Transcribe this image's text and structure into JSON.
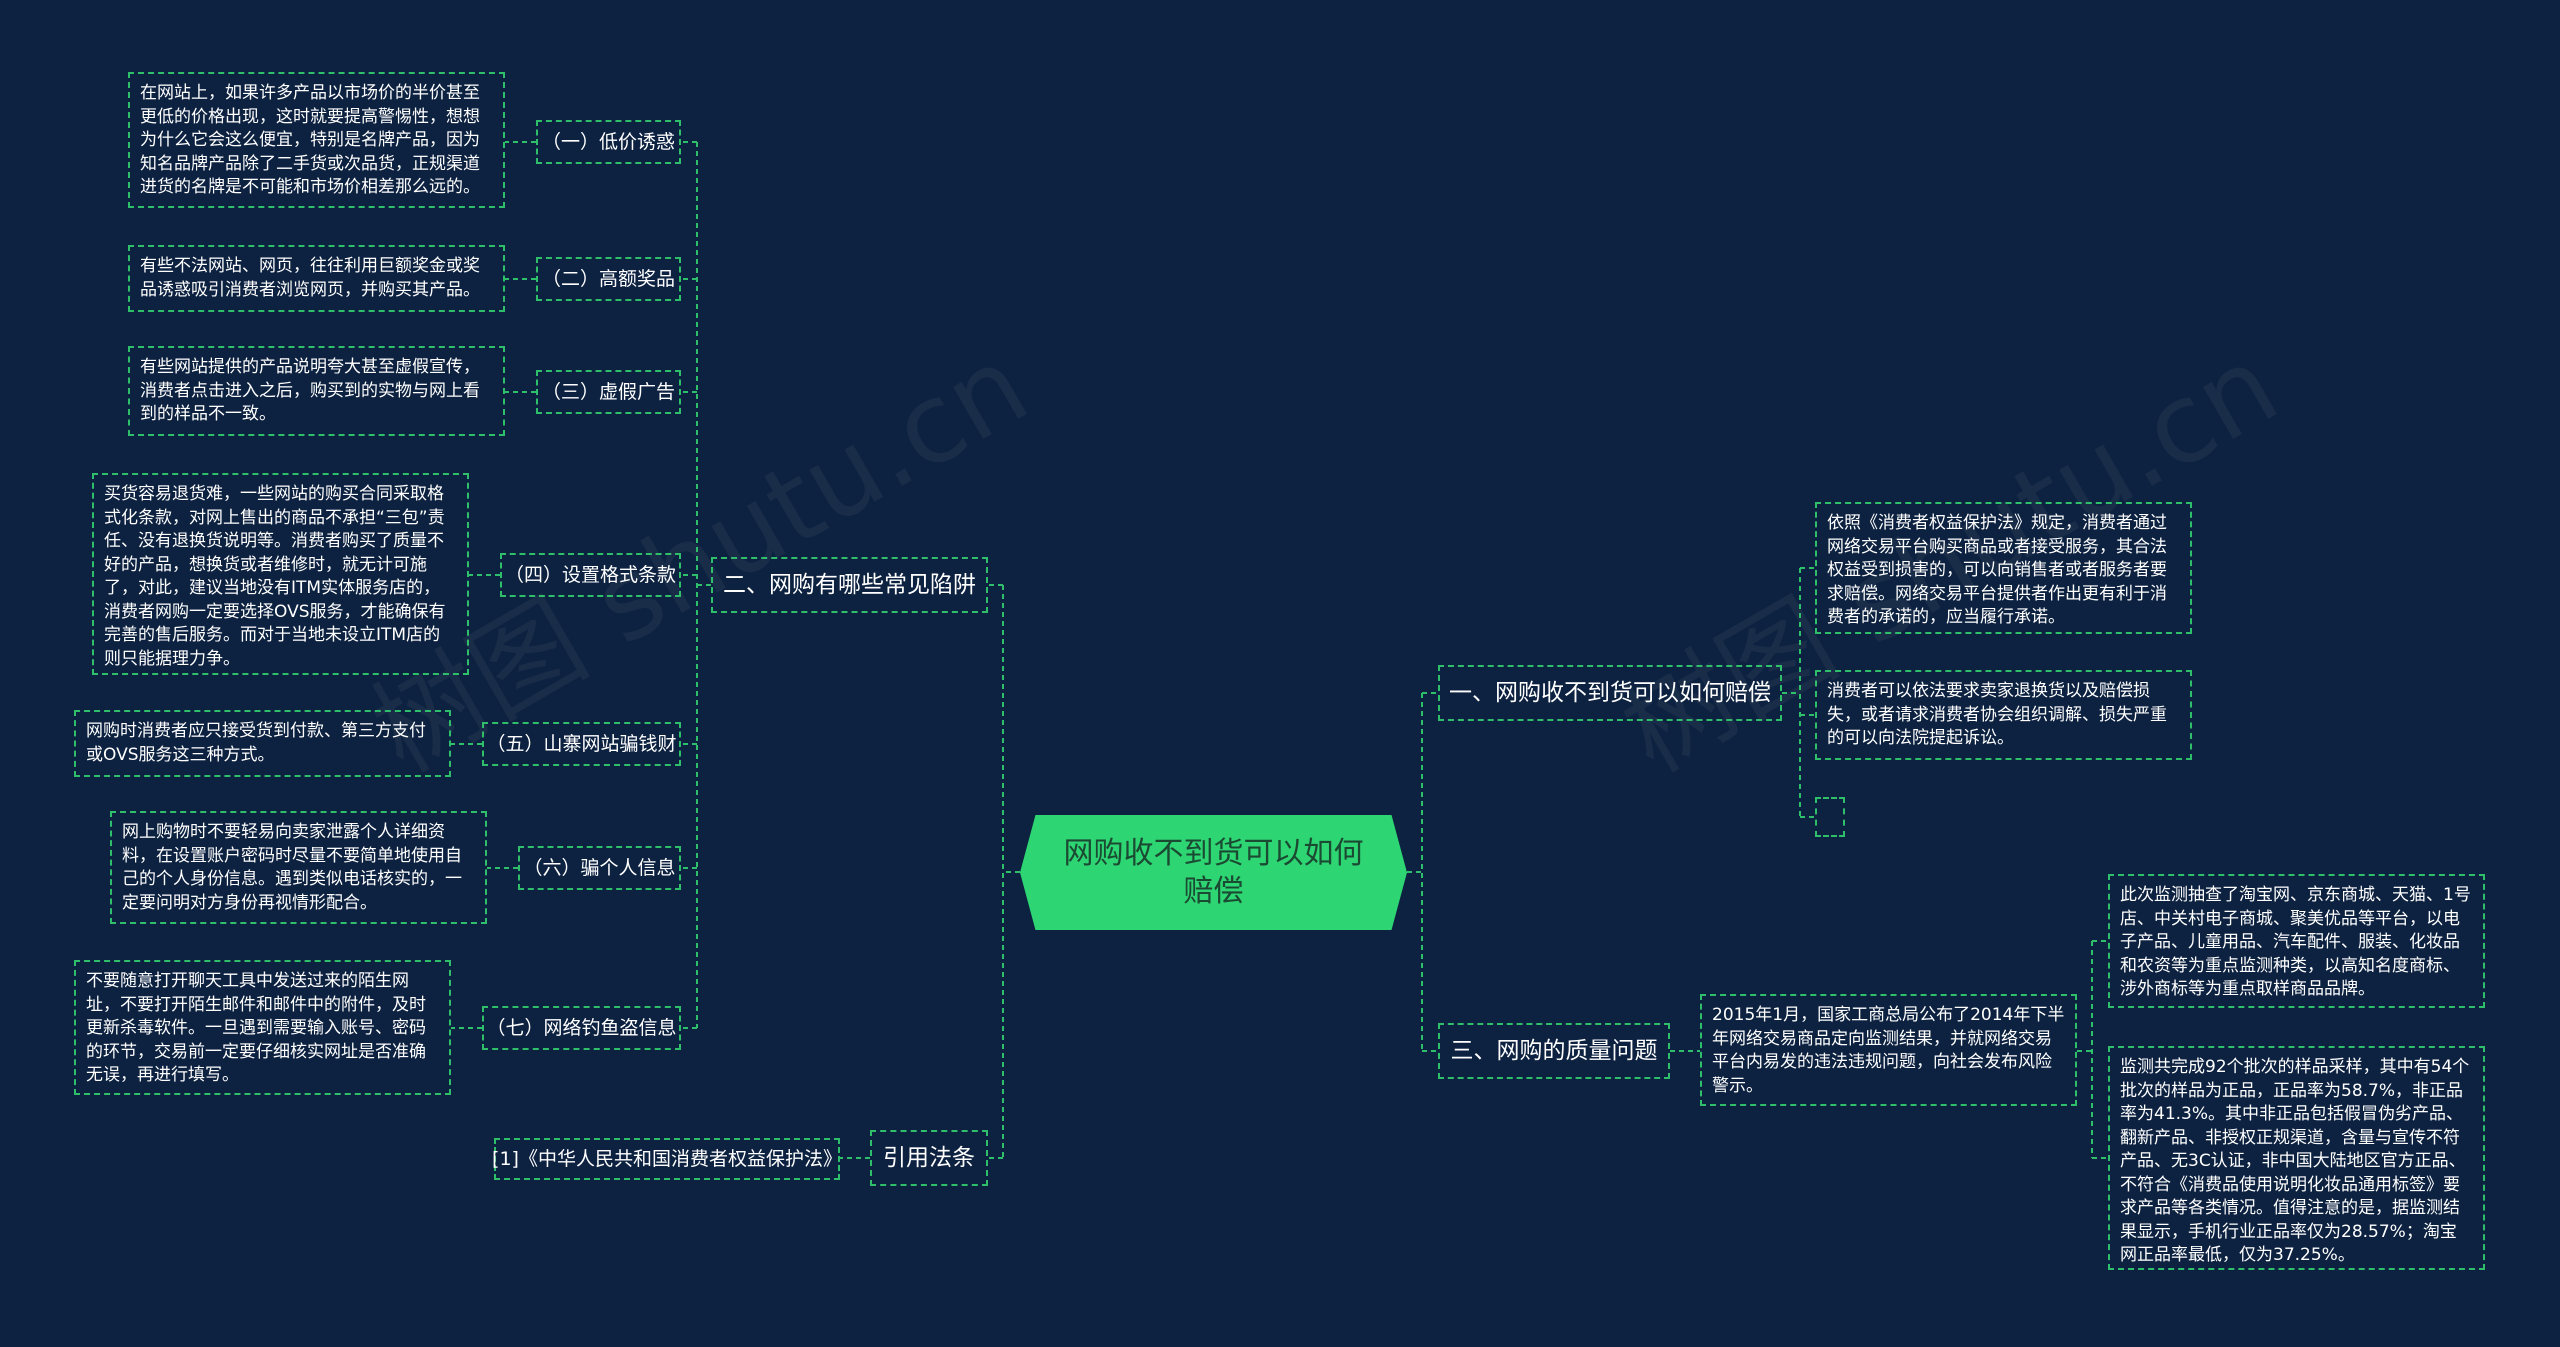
{
  "root": {
    "title": "网购收不到货可以如何赔偿"
  },
  "watermark": "树图 shutu.cn",
  "colors": {
    "background": "#0d2240",
    "accent": "#2ed573",
    "line": "#2fbf6a"
  },
  "left": {
    "branch1": {
      "label": "二、网购有哪些常见陷阱",
      "items": [
        {
          "label": "（一）低价诱惑",
          "detail": "在网站上，如果许多产品以市场价的半价甚至更低的价格出现，这时就要提高警惕性，想想为什么它会这么便宜，特别是名牌产品，因为知名品牌产品除了二手货或次品货，正规渠道进货的名牌是不可能和市场价相差那么远的。"
        },
        {
          "label": "（二）高额奖品",
          "detail": "有些不法网站、网页，往往利用巨额奖金或奖品诱惑吸引消费者浏览网页，并购买其产品。"
        },
        {
          "label": "（三）虚假广告",
          "detail": "有些网站提供的产品说明夸大甚至虚假宣传，消费者点击进入之后，购买到的实物与网上看到的样品不一致。"
        },
        {
          "label": "（四）设置格式条款",
          "detail": "买货容易退货难，一些网站的购买合同采取格式化条款，对网上售出的商品不承担“三包”责任、没有退换货说明等。消费者购买了质量不好的产品，想换货或者维修时，就无计可施了，对此，建议当地没有ITM实体服务店的，消费者网购一定要选择OVS服务，才能确保有完善的售后服务。而对于当地未设立ITM店的则只能据理力争。"
        },
        {
          "label": "（五）山寨网站骗钱财",
          "detail": "网购时消费者应只接受货到付款、第三方支付或OVS服务这三种方式。"
        },
        {
          "label": "（六）骗个人信息",
          "detail": "网上购物时不要轻易向卖家泄露个人详细资料，在设置账户密码时尽量不要简单地使用自己的个人身份信息。遇到类似电话核实的，一定要问明对方身份再视情形配合。"
        },
        {
          "label": "（七）网络钓鱼盗信息",
          "detail": "不要随意打开聊天工具中发送过来的陌生网址，不要打开陌生邮件和邮件中的附件，及时更新杀毒软件。一旦遇到需要输入账号、密码的环节，交易前一定要仔细核实网址是否准确无误，再进行填写。"
        }
      ]
    },
    "branch2": {
      "label": "引用法条",
      "items": [
        {
          "label": "[1]《中华人民共和国消费者权益保护法》"
        }
      ]
    }
  },
  "right": {
    "branch1": {
      "label": "一、网购收不到货可以如何赔偿",
      "items": [
        {
          "detail": "依照《消费者权益保护法》规定，消费者通过网络交易平台购买商品或者接受服务，其合法权益受到损害的，可以向销售者或者服务者要求赔偿。网络交易平台提供者作出更有利于消费者的承诺的，应当履行承诺。"
        },
        {
          "detail": "消费者可以依法要求卖家退换货以及赔偿损失，或者请求消费者协会组织调解、损失严重的可以向法院提起诉讼。"
        },
        {
          "detail": ""
        }
      ]
    },
    "branch2": {
      "label": "三、网购的质量问题",
      "sub": "2015年1月，国家工商总局公布了2014年下半年网络交易商品定向监测结果，并就网络交易平台内易发的违法违规问题，向社会发布风险警示。",
      "items": [
        {
          "detail": "此次监测抽查了淘宝网、京东商城、天猫、1号店、中关村电子商城、聚美优品等平台，以电子产品、儿童用品、汽车配件、服装、化妆品和农资等为重点监测种类，以高知名度商标、涉外商标等为重点取样商品品牌。"
        },
        {
          "detail": "监测共完成92个批次的样品采样，其中有54个批次的样品为正品，正品率为58.7%，非正品率为41.3%。其中非正品包括假冒伪劣产品、翻新产品、非授权正规渠道，含量与宣传不符产品、无3C认证，非中国大陆地区官方正品、不符合《消费品使用说明化妆品通用标签》要求产品等各类情况。值得注意的是，据监测结果显示，手机行业正品率仅为28.57%；淘宝网正品率最低，仅为37.25%。"
        }
      ]
    }
  }
}
